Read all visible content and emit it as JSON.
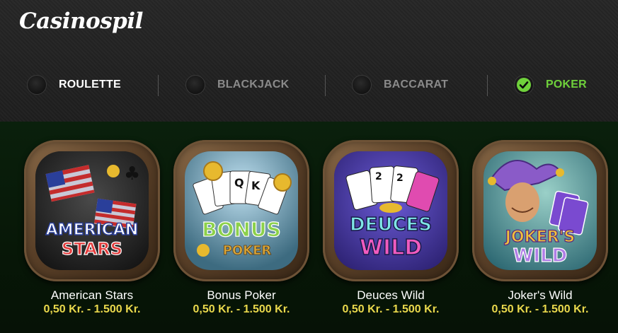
{
  "header": {
    "logo": "Casinospil"
  },
  "tabs": [
    {
      "label": "ROULETTE",
      "selected": false,
      "color": "#ffffff"
    },
    {
      "label": "BLACKJACK",
      "selected": false,
      "color": "#8a8a8a"
    },
    {
      "label": "BACCARAT",
      "selected": false,
      "color": "#8a8a8a"
    },
    {
      "label": "POKER",
      "selected": true,
      "color": "#6fd13b"
    }
  ],
  "games": [
    {
      "title": "American Stars",
      "range": "0,50 Kr. - 1.500 Kr.",
      "art_text": [
        "AMERICAN",
        "STARS"
      ]
    },
    {
      "title": "Bonus Poker",
      "range": "0,50 Kr. - 1.500 Kr.",
      "art_text": [
        "BONUS",
        "POKER"
      ]
    },
    {
      "title": "Deuces Wild",
      "range": "0,50 Kr. - 1.500 Kr.",
      "art_text": [
        "DEUCES",
        "WILD"
      ]
    },
    {
      "title": "Joker's Wild",
      "range": "0,50 Kr. - 1.500 Kr.",
      "art_text": [
        "JOKER'S",
        "WILD"
      ]
    }
  ],
  "colors": {
    "accent_green": "#6fd13b",
    "price_yellow": "#e9d84c",
    "check_icon": "check-icon"
  }
}
